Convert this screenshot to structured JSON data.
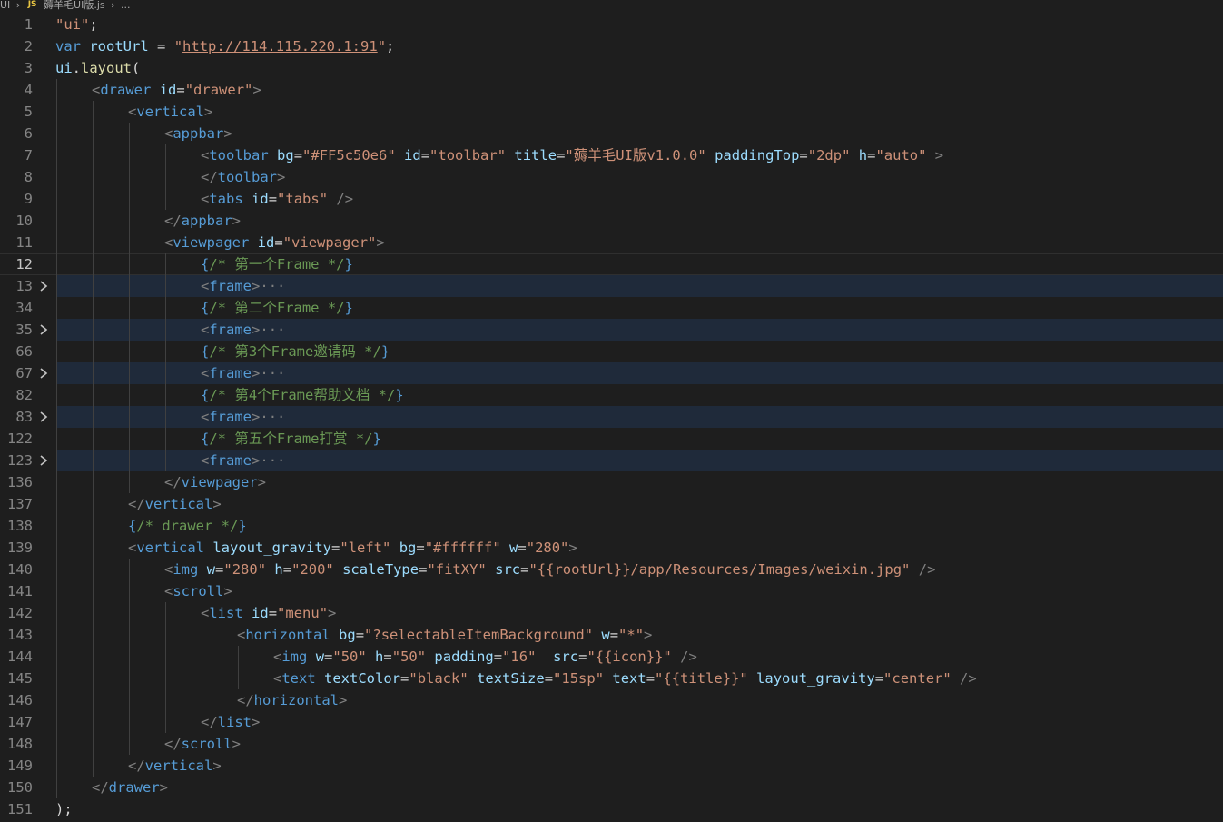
{
  "breadcrumb": {
    "folder": "UI",
    "file_icon": "JS",
    "file": "薅羊毛UI版.js",
    "more": "..."
  },
  "colors": {
    "background": "#1e1e1e",
    "keyword": "#569cd6",
    "attribute": "#9cdcfe",
    "string": "#ce9178",
    "comment": "#6a9955",
    "fold_highlight": "#1f2a3a"
  },
  "lines": [
    {
      "n": "1",
      "indent": 0,
      "text": "\"ui\";"
    },
    {
      "n": "2",
      "indent": 0,
      "text": "var rootUrl = \"http://114.115.220.1:91\";"
    },
    {
      "n": "3",
      "indent": 0,
      "text": "ui.layout("
    },
    {
      "n": "4",
      "indent": 1,
      "text": "<drawer id=\"drawer\">"
    },
    {
      "n": "5",
      "indent": 2,
      "text": "<vertical>"
    },
    {
      "n": "6",
      "indent": 3,
      "text": "<appbar>"
    },
    {
      "n": "7",
      "indent": 4,
      "text": "<toolbar bg=\"#FF5c50e6\" id=\"toolbar\" title=\"薅羊毛UI版v1.0.0\" paddingTop=\"2dp\" h=\"auto\" >"
    },
    {
      "n": "8",
      "indent": 4,
      "text": "</toolbar>"
    },
    {
      "n": "9",
      "indent": 4,
      "text": "<tabs id=\"tabs\" />"
    },
    {
      "n": "10",
      "indent": 3,
      "text": "</appbar>"
    },
    {
      "n": "11",
      "indent": 3,
      "text": "<viewpager id=\"viewpager\">"
    },
    {
      "n": "12",
      "indent": 4,
      "text": "{/* 第一个Frame */}",
      "current": true
    },
    {
      "n": "13",
      "indent": 4,
      "text": "<frame>···",
      "fold": true
    },
    {
      "n": "34",
      "indent": 4,
      "text": "{/* 第二个Frame */}"
    },
    {
      "n": "35",
      "indent": 4,
      "text": "<frame>···",
      "fold": true
    },
    {
      "n": "66",
      "indent": 4,
      "text": "{/* 第3个Frame邀请码 */}"
    },
    {
      "n": "67",
      "indent": 4,
      "text": "<frame>···",
      "fold": true
    },
    {
      "n": "82",
      "indent": 4,
      "text": "{/* 第4个Frame帮助文档 */}"
    },
    {
      "n": "83",
      "indent": 4,
      "text": "<frame>···",
      "fold": true
    },
    {
      "n": "122",
      "indent": 4,
      "text": "{/* 第五个Frame打赏 */}"
    },
    {
      "n": "123",
      "indent": 4,
      "text": "<frame>···",
      "fold": true
    },
    {
      "n": "136",
      "indent": 3,
      "text": "</viewpager>"
    },
    {
      "n": "137",
      "indent": 2,
      "text": "</vertical>"
    },
    {
      "n": "138",
      "indent": 2,
      "text": "{/* drawer */}"
    },
    {
      "n": "139",
      "indent": 2,
      "text": "<vertical layout_gravity=\"left\" bg=\"#ffffff\" w=\"280\">"
    },
    {
      "n": "140",
      "indent": 3,
      "text": "<img w=\"280\" h=\"200\" scaleType=\"fitXY\" src=\"{{rootUrl}}/app/Resources/Images/weixin.jpg\" />"
    },
    {
      "n": "141",
      "indent": 3,
      "text": "<scroll>"
    },
    {
      "n": "142",
      "indent": 4,
      "text": "<list id=\"menu\">"
    },
    {
      "n": "143",
      "indent": 5,
      "text": "<horizontal bg=\"?selectableItemBackground\" w=\"*\">"
    },
    {
      "n": "144",
      "indent": 6,
      "text": "<img w=\"50\" h=\"50\" padding=\"16\"  src=\"{{icon}}\" />"
    },
    {
      "n": "145",
      "indent": 6,
      "text": "<text textColor=\"black\" textSize=\"15sp\" text=\"{{title}}\" layout_gravity=\"center\" />"
    },
    {
      "n": "146",
      "indent": 5,
      "text": "</horizontal>"
    },
    {
      "n": "147",
      "indent": 4,
      "text": "</list>"
    },
    {
      "n": "148",
      "indent": 3,
      "text": "</scroll>"
    },
    {
      "n": "149",
      "indent": 2,
      "text": "</vertical>"
    },
    {
      "n": "150",
      "indent": 1,
      "text": "</drawer>"
    },
    {
      "n": "151",
      "indent": 0,
      "text": ");"
    }
  ]
}
